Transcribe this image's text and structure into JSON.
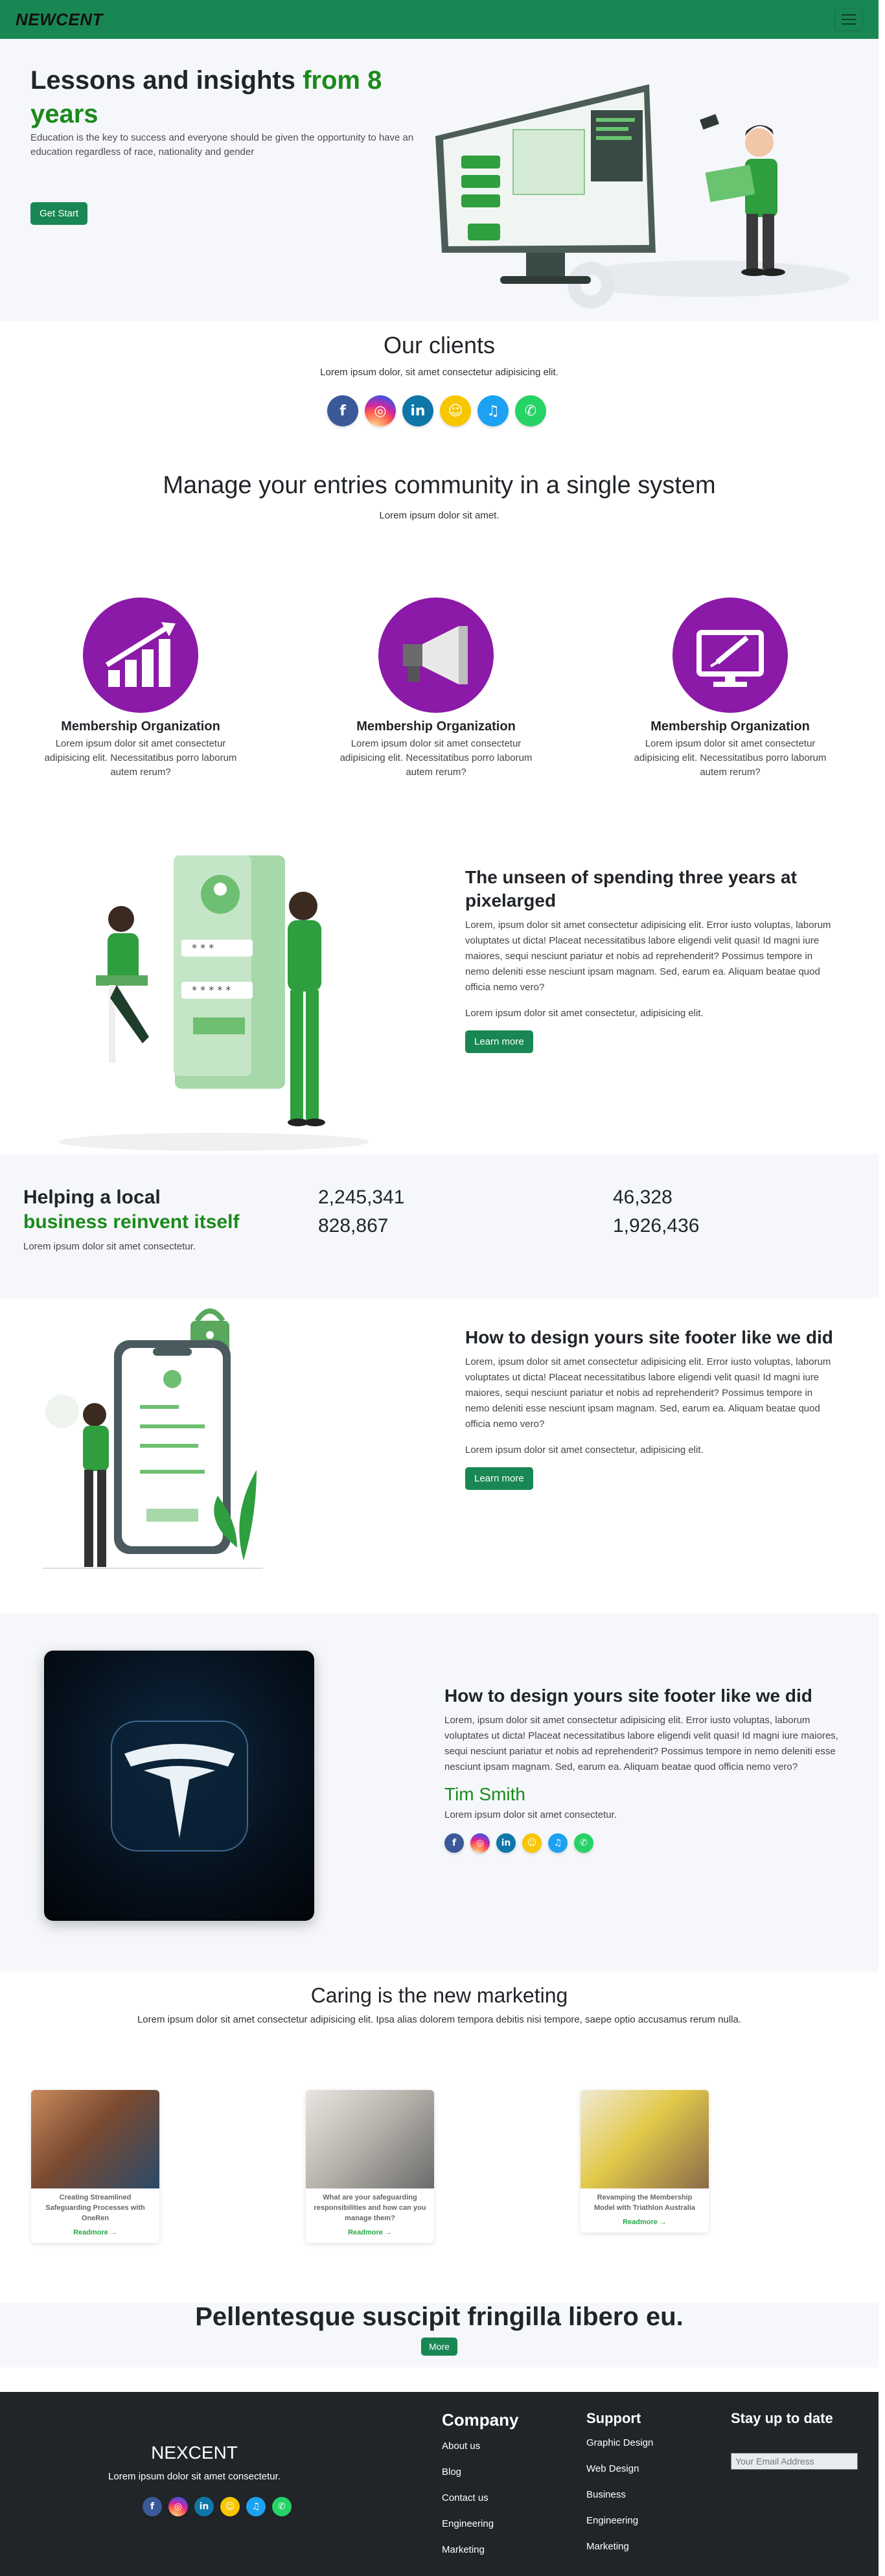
{
  "navbar": {
    "brand": "NEWCENT",
    "toggle_icon": "menu-icon"
  },
  "hero": {
    "title_main": "Lessons and insights ",
    "title_highlight": "from 8 years",
    "description": "Education is the key to success and everyone should be given the opportunity to have an education regardless of race, nationality and gender",
    "button": "Get Start",
    "accent_color": "#198754"
  },
  "clients": {
    "title": "Our clients",
    "subtitle": "Lorem ipsum dolor, sit amet consectetur adipisicing elit.",
    "icons": [
      "facebook-icon",
      "instagram-icon",
      "linkedin-icon",
      "snapchat-icon",
      "twitter-icon",
      "whatsapp-icon"
    ]
  },
  "community": {
    "title": "Manage your entries community in a single system",
    "subtitle": "Lorem ipsum dolor sit amet.",
    "features": [
      {
        "icon": "growth-chart-icon",
        "title": "Membership Organization",
        "text": "Lorem ipsum dolor sit amet consectetur adipisicing elit. Necessitatibus porro laborum autem rerum?"
      },
      {
        "icon": "megaphone-icon",
        "title": "Membership Organization",
        "text": "Lorem ipsum dolor sit amet consectetur adipisicing elit. Necessitatibus porro laborum autem rerum?"
      },
      {
        "icon": "monitor-pen-icon",
        "title": "Membership Organization",
        "text": "Lorem ipsum dolor sit amet consectetur adipisicing elit. Necessitatibus porro laborum autem rerum?"
      }
    ],
    "feature_color": "#8b1aa8"
  },
  "unseen": {
    "title": "The unseen of spending three years at pixelarged",
    "paragraph": "Lorem, ipsum dolor sit amet consectetur adipisicing elit. Error iusto voluptas, laborum voluptates ut dicta! Placeat necessitatibus labore eligendi velit quasi! Id magni iure maiores, sequi nesciunt pariatur et nobis ad reprehenderit? Possimus tempore in nemo deleniti esse nesciunt ipsam magnam. Sed, earum ea. Aliquam beatae quod officia nemo vero?",
    "note": "Lorem ipsum dolor sit amet consectetur, adipisicing elit.",
    "button": "Learn more"
  },
  "stats": {
    "title_main": "Helping a local",
    "title_highlight": "business reinvent itself",
    "lead": "Lorem ipsum dolor sit amet consectetur.",
    "numbers": [
      "2,245,341",
      "46,328",
      "828,867",
      "1,926,436"
    ]
  },
  "footer_design": {
    "title": "How to design yours site footer like we did",
    "paragraph": "Lorem, ipsum dolor sit amet consectetur adipisicing elit. Error iusto voluptas, laborum voluptates ut dicta! Placeat necessitatibus labore eligendi velit quasi! Id magni iure maiores, sequi nesciunt pariatur et nobis ad reprehenderit? Possimus tempore in nemo deleniti esse nesciunt ipsam magnam. Sed, earum ea. Aliquam beatae quod officia nemo vero?",
    "note": "Lorem ipsum dolor sit amet consectetur, adipisicing elit.",
    "button": "Learn more"
  },
  "testimonial": {
    "title": "How to design yours site footer like we did",
    "paragraph": "Lorem, ipsum dolor sit amet consectetur adipisicing elit. Error iusto voluptas, laborum voluptates ut dicta! Placeat necessitatibus labore eligendi velit quasi! Id magni iure maiores, sequi nesciunt pariatur et nobis ad reprehenderit? Possimus tempore in nemo deleniti esse nesciunt ipsam magnam. Sed, earum ea. Aliquam beatae quod officia nemo vero?",
    "author": "Tim Smith",
    "author_note": "Lorem ipsum dolor sit amet consectetur.",
    "image_icon": "tesla-logo-icon"
  },
  "marketing": {
    "title": "Caring is the new marketing",
    "subtitle": "Lorem ipsum dolor sit amet consectetur adipisicing elit. Ipsa alias dolorem tempora debitis nisi tempore, saepe optio accusamus rerum nulla.",
    "cards": [
      {
        "title": "Creating Streamlined Safeguarding Processes with OneRen",
        "link": "Readmore →"
      },
      {
        "title": "What are your safeguarding responsibilities and how can you manage them?",
        "link": "Readmore →"
      },
      {
        "title": "Revamping the Membership Model with Triathlon Australia",
        "link": "Readmore →"
      }
    ]
  },
  "cta": {
    "title": "Pellentesque suscipit fringilla libero eu.",
    "button": "More"
  },
  "footer": {
    "brand": "NEXCENT",
    "text": "Lorem ipsum dolor sit amet consectetur.",
    "company": {
      "title": "Company",
      "links": [
        "About us",
        "Blog",
        "Contact us",
        "Engineering",
        "Marketing"
      ]
    },
    "support": {
      "title": "Support",
      "links": [
        "Graphic Design",
        "Web Design",
        "Business",
        "Engineering",
        "Marketing"
      ]
    },
    "newsletter": {
      "title": "Stay up to date",
      "placeholder": "Your Email Address"
    },
    "background": "#212529"
  }
}
